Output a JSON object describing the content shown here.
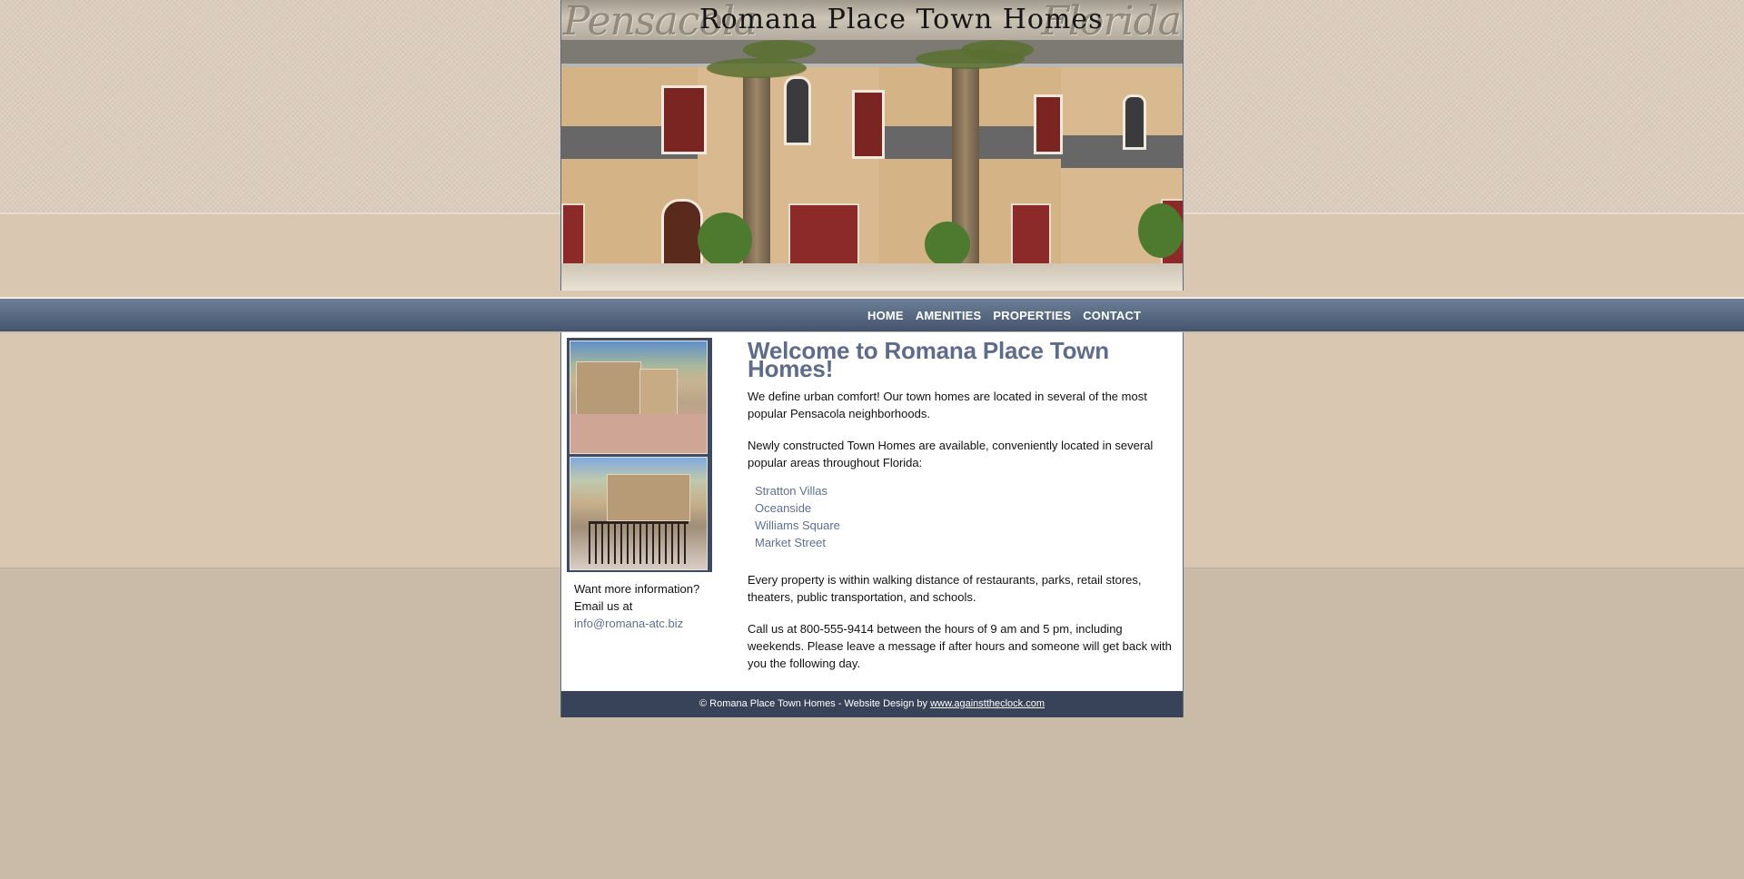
{
  "header": {
    "title": "Romana Place Town Homes",
    "left_script": "Pensacola",
    "right_script": "Florida"
  },
  "nav": {
    "items": [
      "HOME",
      "AMENITIES",
      "PROPERTIES",
      "CONTACT"
    ]
  },
  "sidebar": {
    "info_line1": "Want more information?",
    "info_line2": "Email us at",
    "email": "info@romana-atc.biz"
  },
  "main": {
    "heading": "Welcome to Romana Place Town Homes!",
    "para1": "We define urban comfort! Our town homes are located in several of the most popular Pensacola neighborhoods.",
    "para2": "Newly constructed Town Homes are available, conveniently located in several popular areas throughout Florida:",
    "properties": [
      "Stratton Villas",
      "Oceanside",
      "Williams Square",
      "Market Street"
    ],
    "para3": "Every property is within walking distance of restaurants, parks, retail stores, theaters, public transportation, and schools.",
    "para4": "Call us at 800-555-9414 between the hours of 9 am and 5 pm, including weekends. Please leave a message if after hours and someone will get back with you the following day."
  },
  "footer": {
    "text": "© Romana Place Town Homes - Website Design by",
    "link": "www.againsttheclock.com"
  },
  "colors": {
    "nav_bar": "#4f5f78",
    "heading": "#5e6c8a",
    "link": "#5e6f8f",
    "footer": "#384359"
  }
}
